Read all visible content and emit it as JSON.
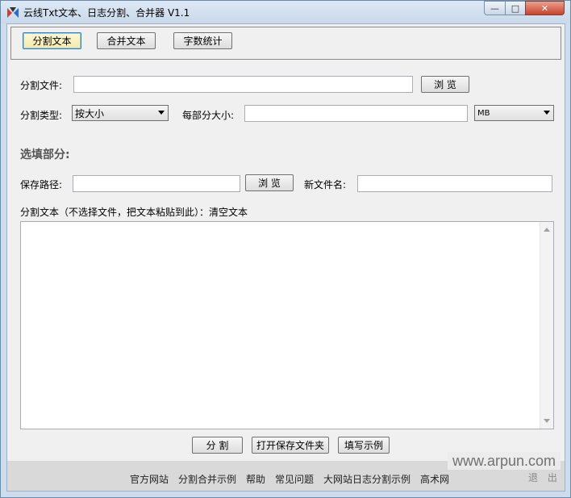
{
  "window": {
    "title": "云线Txt文本、日志分割、合并器 V1.1",
    "controls": {
      "minimize": "—",
      "maximize": "□",
      "close": "✕"
    }
  },
  "tabs": [
    {
      "label": "分割文本",
      "active": true
    },
    {
      "label": "合并文本",
      "active": false
    },
    {
      "label": "字数统计",
      "active": false
    }
  ],
  "form": {
    "split_file_label": "分割文件:",
    "split_file_value": "",
    "browse_label": "浏 览",
    "split_type_label": "分割类型:",
    "split_type_value": "按大小",
    "part_size_label": "每部分大小:",
    "part_size_value": "",
    "unit_value": "MB",
    "optional_section": "选填部分:",
    "save_path_label": "保存路径:",
    "save_path_value": "",
    "browse2_label": "浏 览",
    "new_filename_label": "新文件名:",
    "new_filename_value": "",
    "text_hint": "分割文本（不选择文件，把文本粘贴到此）：",
    "clear_text": "清空文本",
    "text_value": ""
  },
  "actions": {
    "split": "分 割",
    "open_folder": "打开保存文件夹",
    "fill_example": "填写示例"
  },
  "footer": {
    "links": [
      "官方网站",
      "分割合并示例",
      "帮助",
      "常见问题",
      "大网站日志分割示例",
      "高术网"
    ],
    "exit": "退 出"
  },
  "watermark": "www.arpun.com"
}
